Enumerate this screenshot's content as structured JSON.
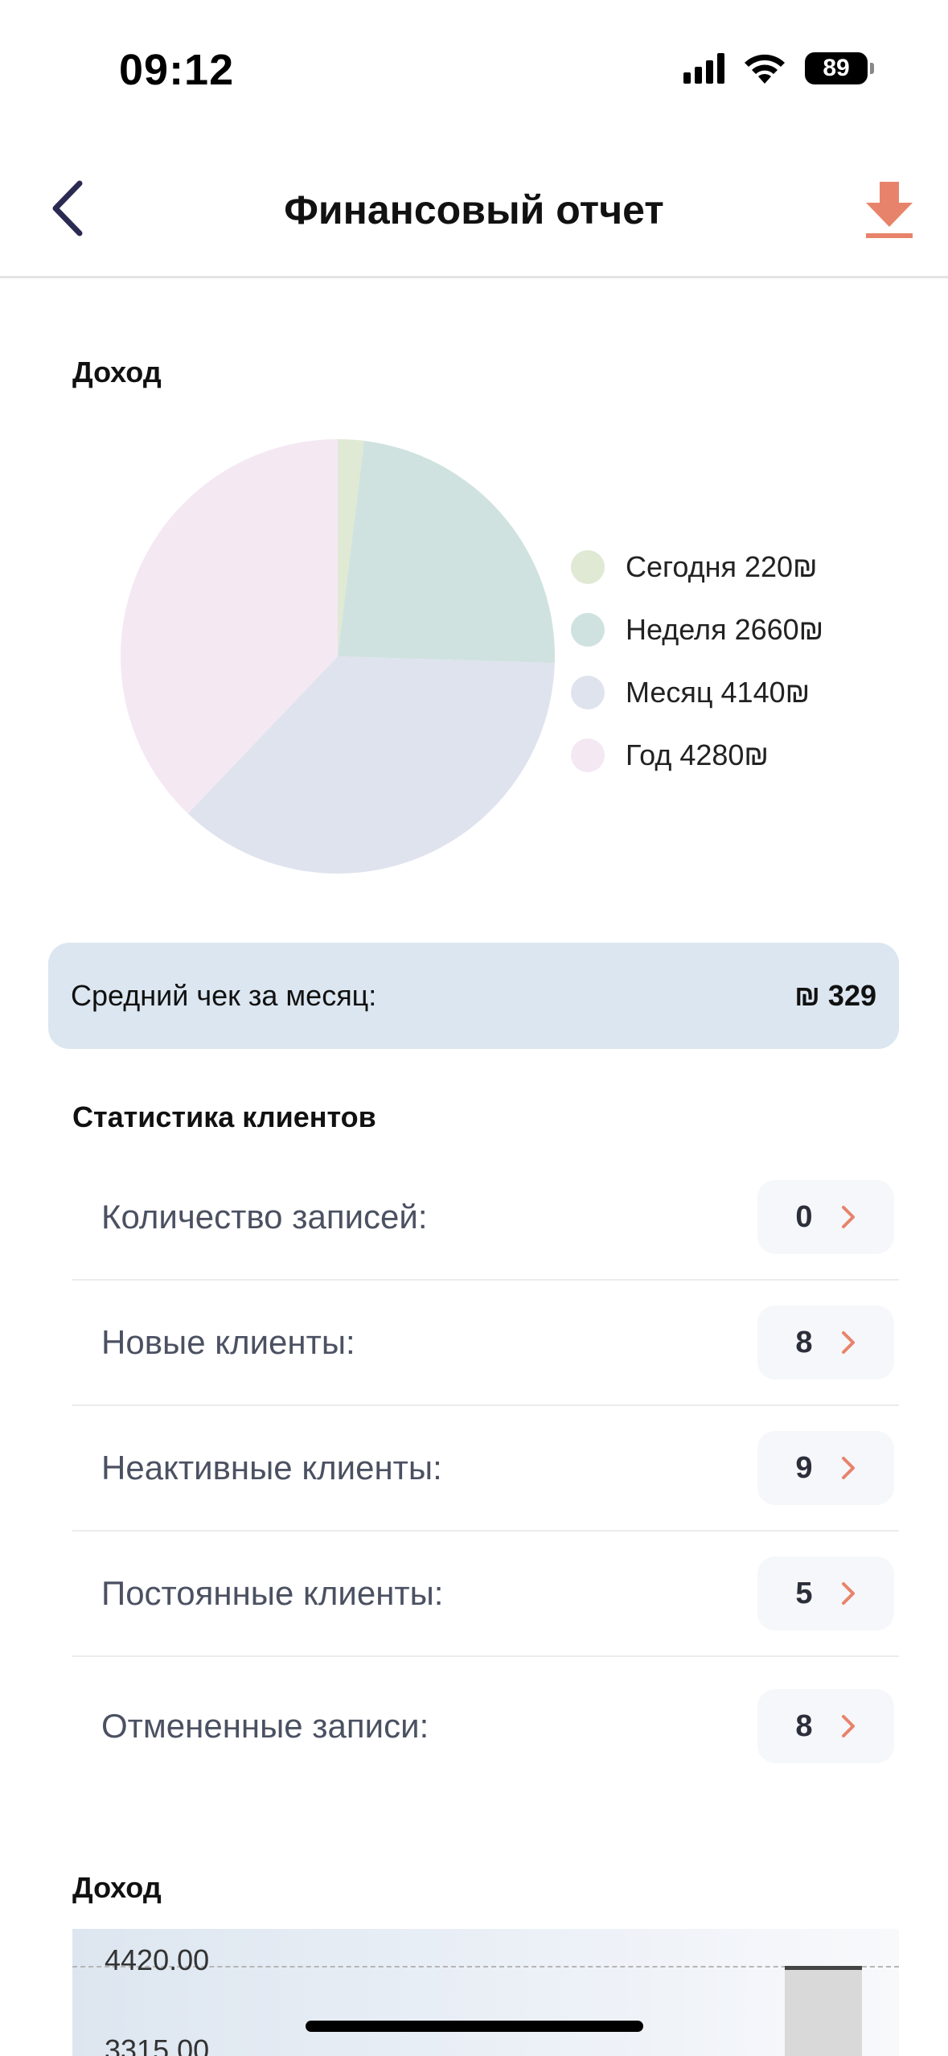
{
  "status_bar": {
    "time": "09:12",
    "battery": "89"
  },
  "nav": {
    "title": "Финансовый отчет"
  },
  "income_section": {
    "title": "Доход"
  },
  "chart_data": [
    {
      "type": "pie",
      "series": [
        {
          "name": "Сегодня",
          "value": 220,
          "label": "Сегодня 220₪",
          "color": "#dfe9d3"
        },
        {
          "name": "Неделя",
          "value": 2660,
          "label": "Неделя 2660₪",
          "color": "#cfe2df"
        },
        {
          "name": "Месяц",
          "value": 4140,
          "label": "Месяц 4140₪",
          "color": "#dfe3ee"
        },
        {
          "name": "Год",
          "value": 4280,
          "label": "Год 4280₪",
          "color": "#f4e8f3"
        }
      ],
      "legend_placement": "right"
    },
    {
      "type": "bar",
      "title": "Доход",
      "yticks": [
        "4420.00",
        "3315.00"
      ],
      "grid": true
    }
  ],
  "avg_check": {
    "label": "Средний чек за месяц:",
    "value": "₪ 329"
  },
  "client_stats": {
    "title": "Статистика клиентов",
    "rows": [
      {
        "label": "Количество записей:",
        "value": "0"
      },
      {
        "label": "Новые клиенты:",
        "value": "8"
      },
      {
        "label": "Неактивные клиенты:",
        "value": "9"
      },
      {
        "label": "Постоянные клиенты:",
        "value": "5"
      },
      {
        "label": "Отмененные записи:",
        "value": "8"
      }
    ]
  },
  "income_chart": {
    "title": "Доход",
    "tick_top": "4420.00",
    "tick_bottom": "3315.00"
  },
  "colors": {
    "accent": "#e8836b",
    "dark": "#2a2a52",
    "card": "#dbe6f0"
  }
}
